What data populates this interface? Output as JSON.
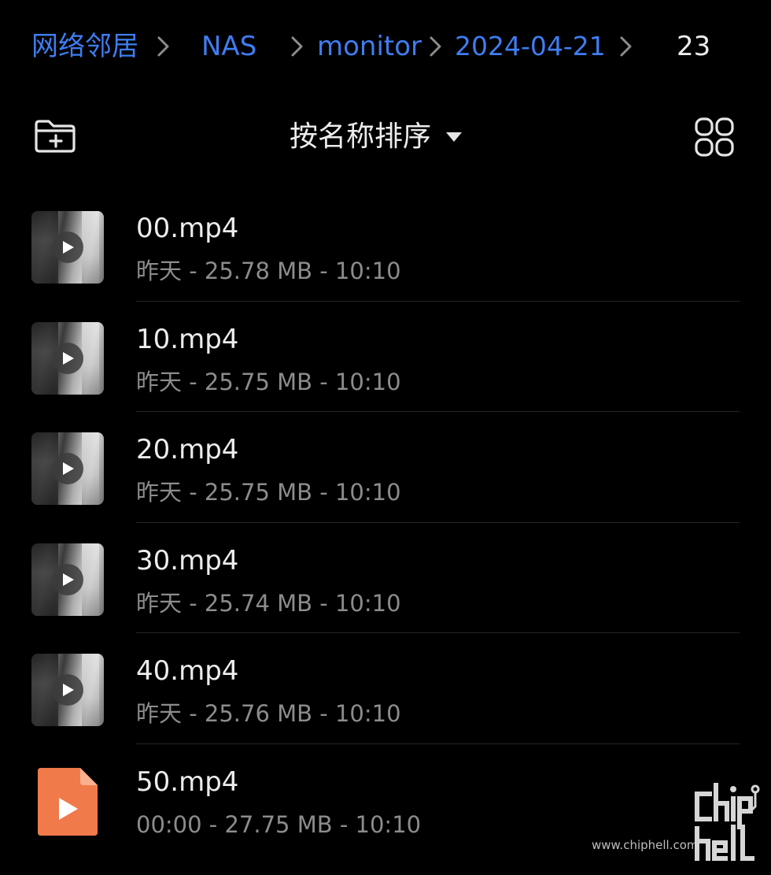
{
  "breadcrumb": {
    "items": [
      {
        "label": "网络邻居"
      },
      {
        "label": "NAS"
      },
      {
        "label": "monitor"
      },
      {
        "label": "2024-04-21"
      },
      {
        "label": "23"
      }
    ]
  },
  "toolbar": {
    "new_folder_icon": "folder-plus-icon",
    "sort_label": "按名称排序",
    "sort_caret_icon": "caret-down-icon",
    "view_toggle_icon": "grid-view-icon"
  },
  "files": [
    {
      "name": "00.mp4",
      "meta": "昨天 - 25.78 MB - 10:10",
      "thumb": "video-thumbnail"
    },
    {
      "name": "10.mp4",
      "meta": "昨天 - 25.75 MB - 10:10",
      "thumb": "video-thumbnail"
    },
    {
      "name": "20.mp4",
      "meta": "昨天 - 25.75 MB - 10:10",
      "thumb": "video-thumbnail"
    },
    {
      "name": "30.mp4",
      "meta": "昨天 - 25.74 MB - 10:10",
      "thumb": "video-thumbnail"
    },
    {
      "name": "40.mp4",
      "meta": "昨天 - 25.76 MB - 10:10",
      "thumb": "video-thumbnail"
    },
    {
      "name": "50.mp4",
      "meta": "00:00 - 27.75 MB - 10:10",
      "thumb": "video-file-icon"
    }
  ],
  "watermark": {
    "text": "www.chiphell.com",
    "logo_text": "chiphell"
  },
  "colors": {
    "background": "#000000",
    "link_blue": "#3f7df1",
    "primary_text": "#ececec",
    "secondary_text": "#8c8c8c",
    "file_icon_orange": "#f07a4a"
  }
}
